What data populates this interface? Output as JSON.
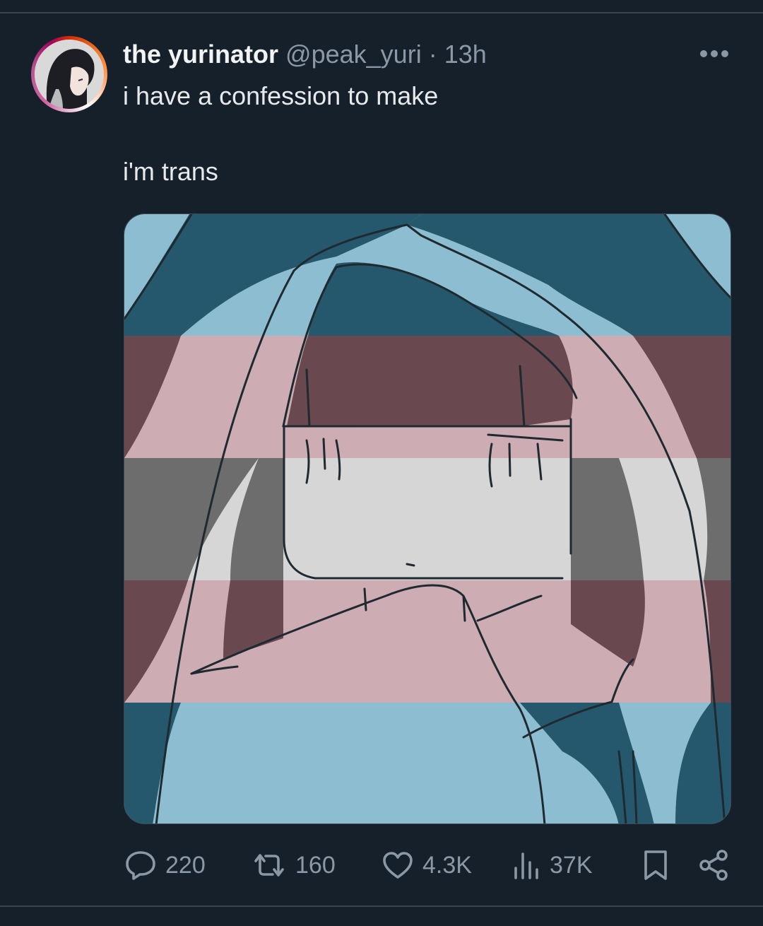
{
  "tweet": {
    "display_name": "the yurinator",
    "handle": "@peak_yuri",
    "separator": "·",
    "time": "13h",
    "text_line1": "i have a confession to make",
    "text_line2": "i'm trans"
  },
  "stats": {
    "replies": "220",
    "reposts": "160",
    "likes": "4.3K",
    "views": "37K"
  },
  "colors": {
    "background": "#15202b",
    "muted": "#8b98a5",
    "flag_blue": "#8dbdd0",
    "flag_pink": "#cdadb3",
    "flag_white": "#d6d6d6"
  },
  "icons": [
    "more-icon",
    "reply-icon",
    "repost-icon",
    "like-icon",
    "views-icon",
    "bookmark-icon",
    "share-icon"
  ]
}
